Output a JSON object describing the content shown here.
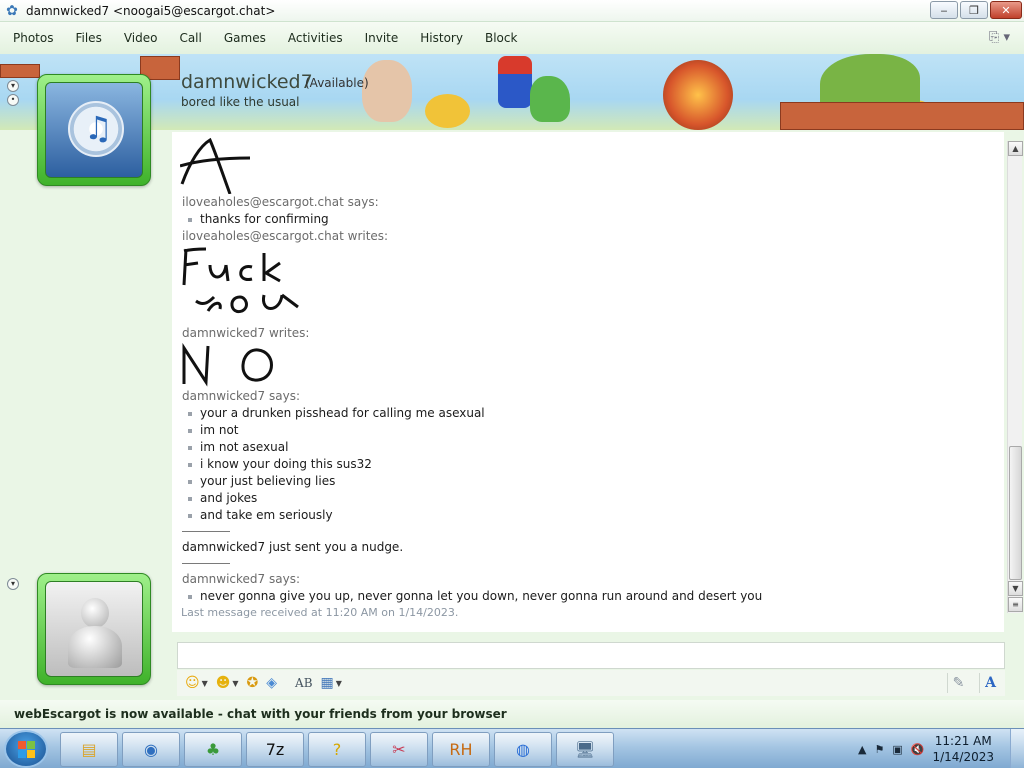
{
  "window": {
    "title": "damnwicked7 <noogai5@escargot.chat>",
    "controls": {
      "minimize": "‒",
      "maximize": "❐",
      "close": "✕"
    }
  },
  "menu": [
    "Photos",
    "Files",
    "Video",
    "Call",
    "Games",
    "Activities",
    "Invite",
    "History",
    "Block"
  ],
  "menu_right_icon": "⎘ ▾",
  "banner": {
    "name": "damnwicked7",
    "status": "(Available)",
    "personal_message": "bored like the usual"
  },
  "chat": {
    "entries": [
      {
        "sender": "iloveaholes@escargot.chat says:",
        "lines": [
          "thanks for confirming"
        ]
      },
      {
        "sender": "iloveaholes@escargot.chat writes:"
      },
      {
        "sender": "damnwicked7 writes:"
      },
      {
        "sender": "damnwicked7 says:",
        "lines": [
          "your a drunken pisshead for calling me asexual",
          "im not",
          "im not asexual",
          "i know your doing this sus32",
          "your just believing lies",
          "and jokes",
          "and take em seriously"
        ]
      },
      {
        "nudge": "damnwicked7 just sent you a nudge."
      },
      {
        "sender": "damnwicked7 says:",
        "lines": [
          "never gonna give you up, never gonna let you down, never gonna run around and desert you"
        ]
      }
    ],
    "timestamp": "Last message received at 11:20 AM on 1/14/2023."
  },
  "toolbar": {
    "emoticon": "☺",
    "wink": "☻",
    "anim": "✪",
    "nudge": "◈",
    "font": "AB",
    "background": "▦",
    "pen": "✎",
    "text_style": "A"
  },
  "status_bar": "webEscargot is now available - chat with your friends from your browser",
  "taskbar": {
    "buttons": [
      {
        "icon": "▤",
        "color": "#d9a52e"
      },
      {
        "icon": "◉",
        "color": "#2f6fbf"
      },
      {
        "icon": "♣",
        "color": "#3a9a3a"
      },
      {
        "icon": "7z",
        "color": "#111111"
      },
      {
        "icon": "?",
        "color": "#d6a700"
      },
      {
        "icon": "✂",
        "color": "#c83b54"
      },
      {
        "icon": "RH",
        "color": "#c66a12"
      },
      {
        "icon": "◍",
        "color": "#2c6fd6"
      },
      {
        "icon": "🖥",
        "color": "#4a6a8a"
      }
    ],
    "tray_icons": [
      "▲",
      "⚑",
      "▣",
      "🔇"
    ],
    "time": "11:21 AM",
    "date": "1/14/2023"
  },
  "colors": {
    "accent_green": "#3fb22a",
    "taskbar_blue": "#7fa9d1"
  }
}
